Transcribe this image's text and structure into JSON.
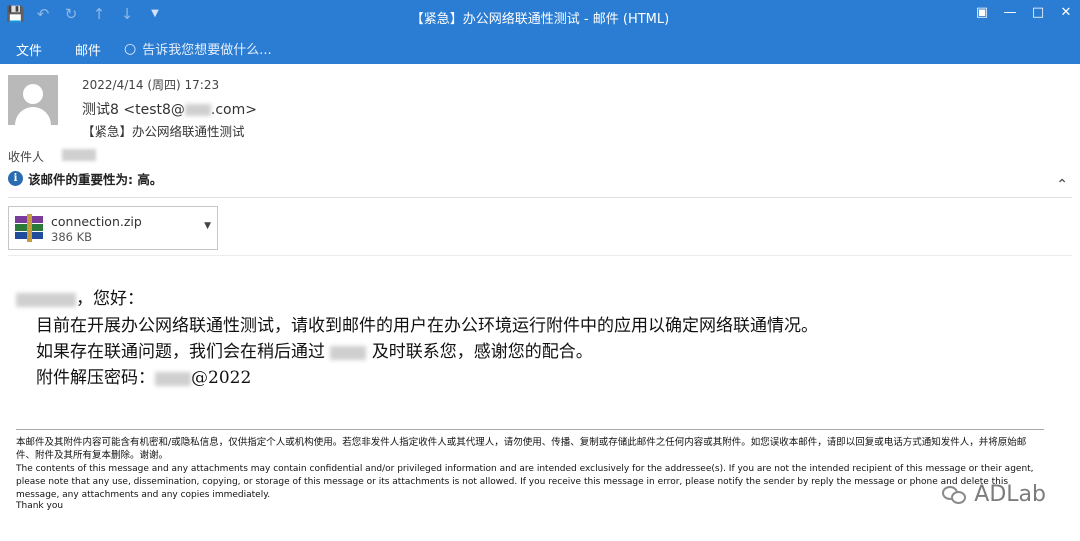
{
  "window": {
    "title": "【紧急】办公网络联通性测试 - 邮件 (HTML)",
    "quick_access": {
      "save_icon": "save-icon",
      "undo_icon": "undo-icon",
      "redo_icon": "redo-icon",
      "up_icon": "up-arrow-icon",
      "down_icon": "down-arrow-icon",
      "more_icon": "customize-icon"
    },
    "controls": [
      "restore-ribbon-icon",
      "minimize-icon",
      "maximize-icon",
      "close-icon"
    ]
  },
  "ribbon": {
    "tabs": [
      {
        "label": "文件"
      },
      {
        "label": "邮件"
      }
    ],
    "tell_me": "告诉我您想要做什么..."
  },
  "header": {
    "date": "2022/4/14 (周四) 17:23",
    "sender": "测试8 <test8@",
    "sender_domain": ".com>",
    "subject": "【紧急】办公网络联通性测试",
    "recipient_label": "收件人",
    "importance": "该邮件的重要性为: 高。"
  },
  "attachment": {
    "name": "connection.zip",
    "size": "386 KB"
  },
  "body": {
    "greeting_suffix": "，您好：",
    "line1": "目前在开展办公网络联通性测试，请收到邮件的用户在办公环境运行附件中的应用以确定网络联通情况。",
    "line2_a": "如果存在联通问题，我们会在稍后通过",
    "line2_b": "及时联系您，感谢您的配合。",
    "line3_a": "附件解压密码：",
    "line3_b": "@2022"
  },
  "disclaimer": {
    "cn": "本邮件及其附件内容可能含有机密和/或隐私信息，仅供指定个人或机构使用。若您非发件人指定收件人或其代理人，请勿使用、传播、复制或存储此邮件之任何内容或其附件。如您误收本邮件，请即以回复或电话方式通知发件人，并将原始邮件、附件及其所有复本删除。谢谢。",
    "en": "The contents of this message and any attachments may contain confidential and/or privileged information and are intended exclusively for the addressee(s). If you are not the intended recipient of this message or their agent, please note that any use, dissemination, copying, or storage of this message or its attachments is not allowed. If you receive this message in error, please notify the sender by reply the message or phone and delete this message, any attachments and any copies immediately.",
    "thanks": "Thank you"
  },
  "watermark": "ADLab"
}
